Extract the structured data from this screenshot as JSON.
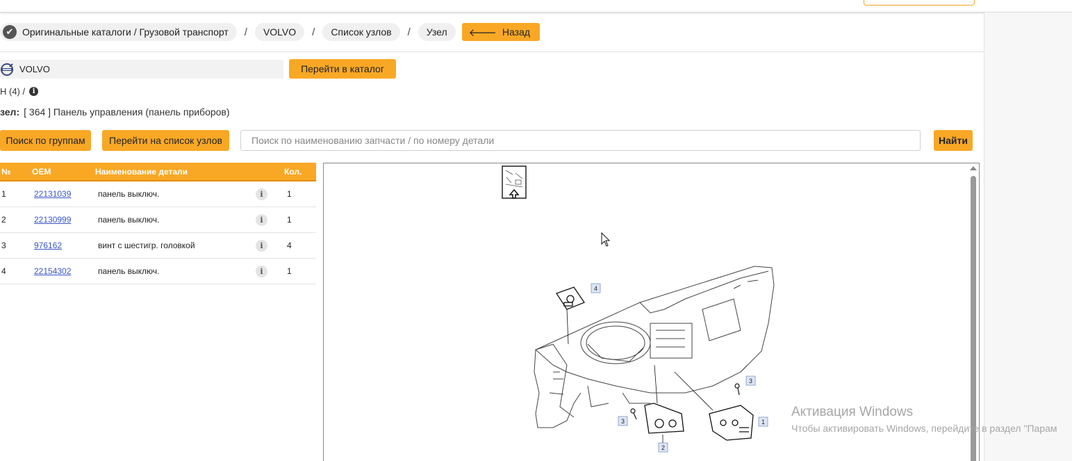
{
  "breadcrumbs": {
    "catalog": "Оригинальные каталоги / Грузовой транспорт",
    "brand": "VOLVO",
    "nodes_list": "Список узлов",
    "node": "Узел",
    "separator": "/",
    "back_label": "Назад"
  },
  "brand_selector": {
    "value": "VOLVO",
    "goto_label": "Перейти в каталог"
  },
  "sub_path": "Н (4) /",
  "node_info": {
    "label": "зел:",
    "value": "[ 364 ] Панель управления (панель приборов)"
  },
  "actions": {
    "search_groups": "Поиск по группам",
    "goto_nodes": "Перейти на список узлов",
    "search_placeholder": "Поиск по наименованию запчасти / по номеру детали",
    "find": "Найти"
  },
  "table": {
    "headers": {
      "no": "№",
      "oem": "OEM",
      "name": "Наименование детали",
      "qty": "Кол."
    },
    "rows": [
      {
        "no": "1",
        "oem": "22131039",
        "name": "панель выключ.",
        "qty": "1"
      },
      {
        "no": "2",
        "oem": "22130999",
        "name": "панель выключ.",
        "qty": "1"
      },
      {
        "no": "3",
        "oem": "976162",
        "name": "винт с шестигр. головкой",
        "qty": "4"
      },
      {
        "no": "4",
        "oem": "22154302",
        "name": "панель выключ.",
        "qty": "1"
      }
    ]
  },
  "diagram": {
    "callouts": [
      "4",
      "3",
      "3",
      "2",
      "1"
    ]
  },
  "watermark": {
    "title": "Активация Windows",
    "subtitle": "Чтобы активировать Windows, перейдите в раздел \"Парам"
  },
  "colors": {
    "accent": "#f9a825",
    "link": "#3a55c8",
    "header_text": "#ffffff"
  },
  "icons": [
    "check-icon",
    "back-arrow-icon",
    "volvo-logo-icon",
    "info-icon",
    "cursor-icon"
  ]
}
